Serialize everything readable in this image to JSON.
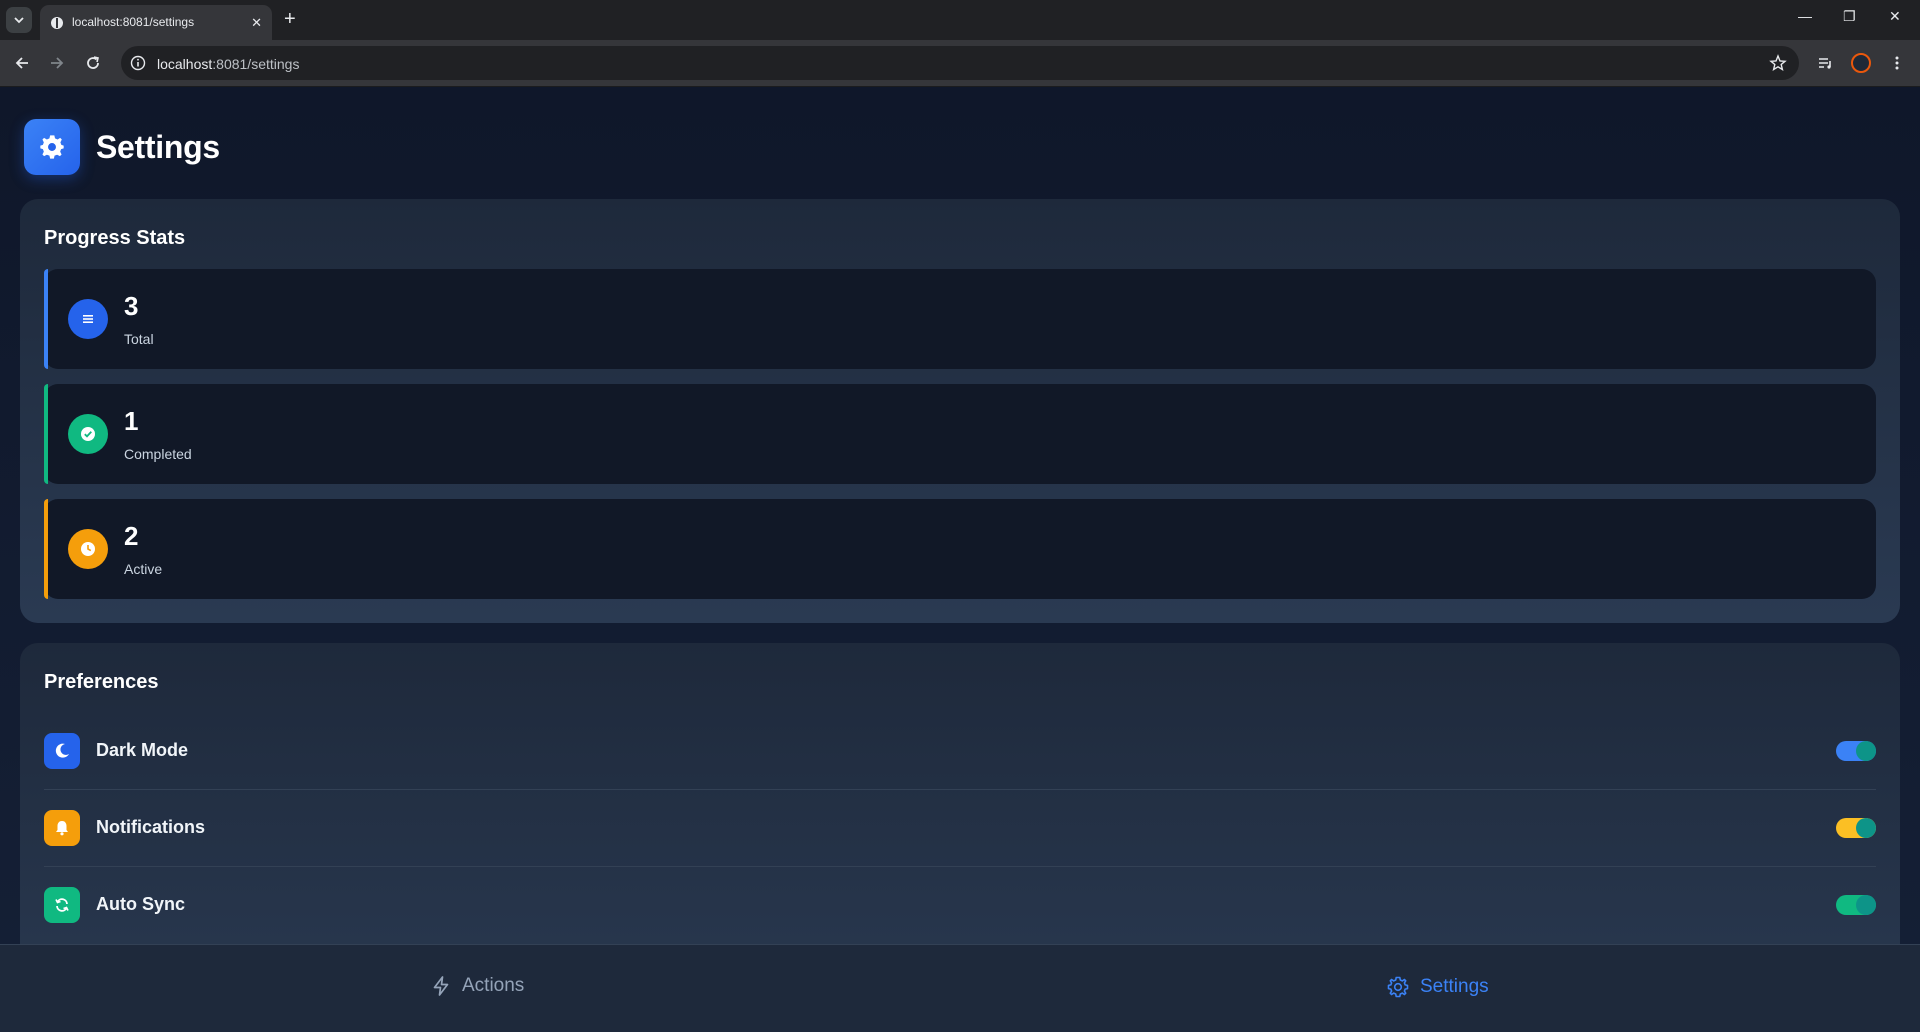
{
  "browser": {
    "tab_title": "localhost:8081/settings",
    "url_host": "localhost",
    "url_rest": ":8081/settings"
  },
  "header": {
    "title": "Settings",
    "icon": "gear-icon"
  },
  "stats": {
    "title": "Progress Stats",
    "items": [
      {
        "value": "3",
        "label": "Total",
        "icon": "list-icon",
        "accent": "#3b82f6"
      },
      {
        "value": "1",
        "label": "Completed",
        "icon": "check-circle-icon",
        "accent": "#10b981"
      },
      {
        "value": "2",
        "label": "Active",
        "icon": "clock-icon",
        "accent": "#f59e0b"
      }
    ]
  },
  "preferences": {
    "title": "Preferences",
    "items": [
      {
        "label": "Dark Mode",
        "icon": "moon-icon",
        "enabled": true,
        "color": "#3b82f6"
      },
      {
        "label": "Notifications",
        "icon": "bell-icon",
        "enabled": true,
        "color": "#f59e0b"
      },
      {
        "label": "Auto Sync",
        "icon": "sync-icon",
        "enabled": true,
        "color": "#10b981"
      }
    ]
  },
  "bottom_nav": {
    "items": [
      {
        "label": "Actions",
        "icon": "lightning-icon",
        "active": false
      },
      {
        "label": "Settings",
        "icon": "gear-icon",
        "active": true
      }
    ],
    "active_color": "#3b82f6",
    "inactive_color": "#94a3b8"
  }
}
